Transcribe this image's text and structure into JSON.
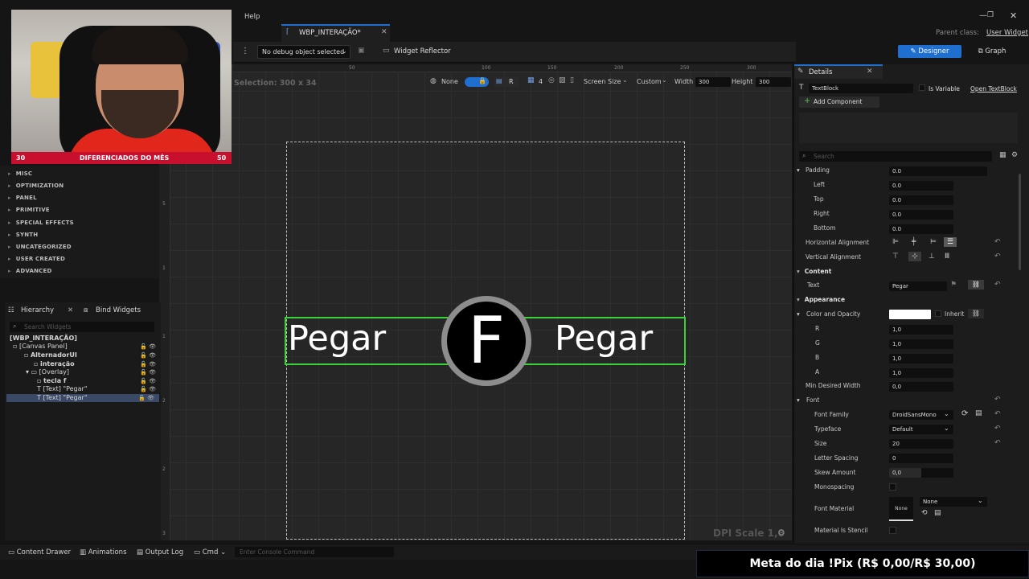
{
  "menubar": {
    "help": "Help",
    "parent_label": "Parent class:",
    "parent_value": "User Widget"
  },
  "tab": {
    "title": "WBP_INTERAÇÃO*"
  },
  "toolbar": {
    "debug": "No debug object selected",
    "reflector": "Widget Reflector",
    "designer": "Designer",
    "graph": "Graph"
  },
  "canvas": {
    "selection": "Selection: 300 x 34",
    "none": "None",
    "r": "R",
    "grid_num": "4",
    "screen_size": "Screen Size",
    "custom": "Custom",
    "width_label": "Width",
    "width_value": "300",
    "height_label": "Height",
    "height_value": "300",
    "dpi": "DPI Scale 1,0",
    "text_left": "Pegar",
    "text_right": "Pegar",
    "key": "F",
    "ruler_top": [
      "50",
      "100",
      "150",
      "200",
      "250",
      "300"
    ],
    "ruler_left": [
      "5",
      "1",
      "1",
      "2",
      "2",
      "3"
    ]
  },
  "webcam": {
    "left_num": "30",
    "banner": "DIFERENCIADOS DO MÊS",
    "right_num": "50"
  },
  "palette": [
    "MISC",
    "OPTIMIZATION",
    "PANEL",
    "PRIMITIVE",
    "SPECIAL EFFECTS",
    "SYNTH",
    "UNCATEGORIZED",
    "USER CREATED",
    "ADVANCED"
  ],
  "hierarchy": {
    "tab": "Hierarchy",
    "bind_tab": "Bind Widgets",
    "search_placeholder": "Search Widgets",
    "rows": [
      "[WBP_INTERAÇÃO]",
      "[Canvas Panel]",
      "AlternadorUI",
      "interação",
      "[Overlay]",
      "tecla f",
      "[Text] \"Pegar\"",
      "[Text] \"Pegar\""
    ]
  },
  "details": {
    "title": "Details",
    "component": "TextBlock",
    "is_variable": "Is Variable",
    "open": "Open TextBlock",
    "add_component": "Add Component",
    "search_placeholder": "Search",
    "padding": "Padding",
    "padding_value": "0.0",
    "left": "Left",
    "left_value": "0.0",
    "top": "Top",
    "top_value": "0.0",
    "right": "Right",
    "right_value": "0.0",
    "bottom": "Bottom",
    "bottom_value": "0.0",
    "halign": "Horizontal Alignment",
    "valign": "Vertical Alignment",
    "content": "Content",
    "text_label": "Text",
    "text_value": "Pegar",
    "appearance": "Appearance",
    "color": "Color and Opacity",
    "inherit": "Inherit",
    "r": "R",
    "r_value": "1,0",
    "g": "G",
    "g_value": "1,0",
    "b": "B",
    "b_value": "1,0",
    "a": "A",
    "a_value": "1,0",
    "min_width": "Min Desired Width",
    "min_width_value": "0,0",
    "font": "Font",
    "font_family": "Font Family",
    "font_family_value": "DroidSansMono",
    "typeface": "Typeface",
    "typeface_value": "Default",
    "size": "Size",
    "size_value": "20",
    "letter_spacing": "Letter Spacing",
    "letter_spacing_value": "0",
    "skew": "Skew Amount",
    "skew_value": "0,0",
    "monospacing": "Monospacing",
    "font_material": "Font Material",
    "font_material_value": "None",
    "swatch_none": "None",
    "stencil": "Material Is Stencil"
  },
  "bottombar": {
    "drawer": "Content Drawer",
    "animations": "Animations",
    "output": "Output Log",
    "cmd": "Cmd",
    "console_placeholder": "Enter Console Command"
  },
  "meta": "Meta do dia !Pix (R$ 0,00/R$ 30,00)",
  "colors": {
    "accent": "#1f6fd1",
    "green_outline": "#3bd13b",
    "banner_red": "#c8102e"
  }
}
